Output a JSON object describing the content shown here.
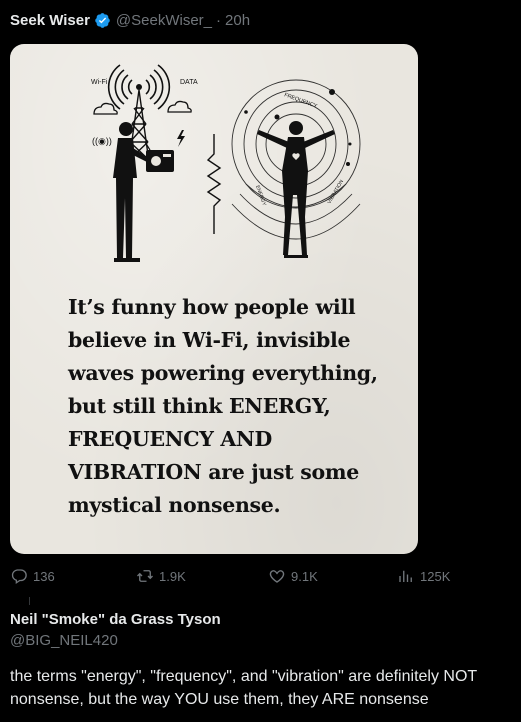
{
  "post": {
    "author_name": "Seek Wiser",
    "handle": "@SeekWiser_",
    "separator": "·",
    "timestamp": "20h",
    "image": {
      "wifi_label": "Wi-Fi",
      "data_label": "DATA",
      "frequency_label": "FREQUENCY",
      "energy_label": "ENERGY",
      "vibration_label": "VIBRATION",
      "quote_lines": [
        "It’s funny how people will",
        "believe in Wi-Fi, invisible",
        "waves powering everything,",
        "but still think ENERGY,",
        "FREQUENCY AND",
        "VIBRATION are just some",
        "mystical nonsense."
      ]
    },
    "actions": {
      "replies": "136",
      "reposts": "1.9K",
      "likes": "9.1K",
      "views": "125K"
    }
  },
  "reply": {
    "author_name": "Neil \"Smoke\" da Grass Tyson",
    "handle": "@BIG_NEIL420",
    "text": "the terms \"energy\", \"frequency\", and \"vibration\" are definitely NOT nonsense, but the way YOU use them, they ARE nonsense"
  },
  "colors": {
    "background": "#000000",
    "text_primary": "#e7e9ea",
    "text_secondary": "#71767b",
    "verified_badge": "#1d9bf0",
    "card_paper": "#e9e6df",
    "ink": "#111111"
  },
  "icons": [
    "verified-badge-icon",
    "reply-icon",
    "repost-icon",
    "like-icon",
    "views-icon"
  ]
}
